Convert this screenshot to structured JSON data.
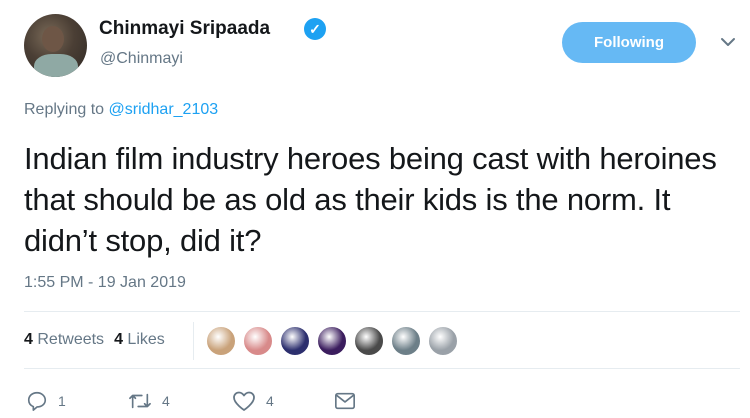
{
  "author": {
    "name": "Chinmayi Sripaada",
    "handle": "@Chinmayi",
    "verified_icon": "✓"
  },
  "follow_button": {
    "label": "Following"
  },
  "reply_context": {
    "prefix": "Replying to ",
    "mention": "@sridhar_2103"
  },
  "tweet": {
    "text": "Indian film industry heroes being cast with heroines that should be as old as their kids is the norm. It didn’t stop, did it?",
    "timestamp": "1:55 PM - 19 Jan 2019"
  },
  "stats": {
    "retweets_count": "4",
    "retweets_label": "Retweets",
    "likes_count": "4",
    "likes_label": "Likes"
  },
  "liker_avatars": [
    {
      "icon": "avatar-1",
      "color": "#c9a27a"
    },
    {
      "icon": "avatar-2",
      "color": "#d88a8a"
    },
    {
      "icon": "avatar-3",
      "color": "#2c2f6e"
    },
    {
      "icon": "avatar-4",
      "color": "#3b1d5e"
    },
    {
      "icon": "avatar-5",
      "color": "#4a4a4a"
    },
    {
      "icon": "avatar-6",
      "color": "#6d7f88"
    },
    {
      "icon": "avatar-7",
      "color": "#9aa1a8"
    }
  ],
  "actions": {
    "reply_count": "1",
    "retweet_count": "4",
    "like_count": "4"
  },
  "colors": {
    "accent": "#1da1f2",
    "muted": "#657786",
    "text": "#14171a"
  }
}
